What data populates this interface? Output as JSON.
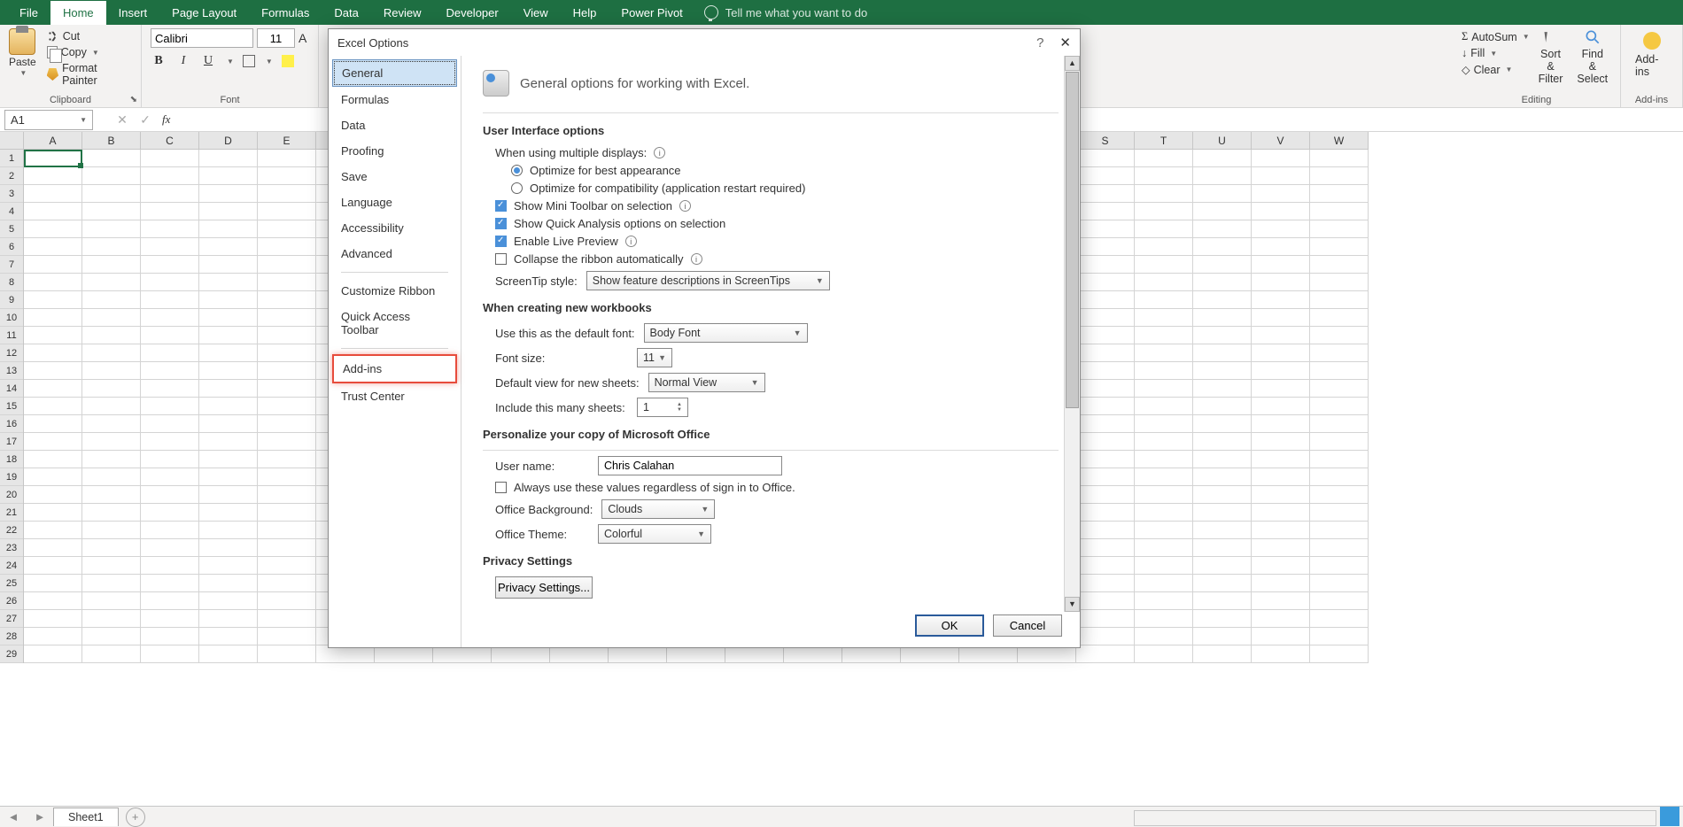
{
  "ribbon": {
    "tabs": [
      "File",
      "Home",
      "Insert",
      "Page Layout",
      "Formulas",
      "Data",
      "Review",
      "Developer",
      "View",
      "Help",
      "Power Pivot"
    ],
    "tellme": "Tell me what you want to do",
    "clipboard": {
      "paste": "Paste",
      "cut": "Cut",
      "copy": "Copy",
      "fmt": "Format Painter",
      "label": "Clipboard"
    },
    "font": {
      "name": "Calibri",
      "size": "11",
      "label": "Font",
      "bold": "B",
      "italic": "I",
      "underline": "U",
      "aa": "A"
    },
    "editing": {
      "autosum": "AutoSum",
      "fill": "Fill",
      "clear": "Clear",
      "sort": "Sort & Filter",
      "find": "Find & Select",
      "label": "Editing"
    },
    "addins": {
      "label": "Add-ins",
      "group": "Add-ins"
    }
  },
  "formulabar": {
    "cell": "A1",
    "fx": "fx"
  },
  "grid": {
    "cols": [
      "A",
      "B",
      "C",
      "D",
      "E",
      "",
      "",
      "",
      "",
      "",
      "",
      "",
      "",
      "",
      "",
      "",
      "",
      "",
      "S",
      "T",
      "U",
      "V",
      "W"
    ],
    "rows_shown": 29
  },
  "sheets": {
    "active": "Sheet1"
  },
  "dialog": {
    "title": "Excel Options",
    "nav": [
      "General",
      "Formulas",
      "Data",
      "Proofing",
      "Save",
      "Language",
      "Accessibility",
      "Advanced",
      "Customize Ribbon",
      "Quick Access Toolbar",
      "Add-ins",
      "Trust Center"
    ],
    "header": "General options for working with Excel.",
    "s1": {
      "title": "User Interface options",
      "multi": "When using multiple displays:",
      "opt1": "Optimize for best appearance",
      "opt2": "Optimize for compatibility (application restart required)",
      "mini": "Show Mini Toolbar on selection",
      "quick": "Show Quick Analysis options on selection",
      "live": "Enable Live Preview",
      "collapse": "Collapse the ribbon automatically",
      "screentip_l": "ScreenTip style:",
      "screentip_v": "Show feature descriptions in ScreenTips"
    },
    "s2": {
      "title": "When creating new workbooks",
      "font_l": "Use this as the default font:",
      "font_v": "Body Font",
      "size_l": "Font size:",
      "size_v": "11",
      "view_l": "Default view for new sheets:",
      "view_v": "Normal View",
      "sheets_l": "Include this many sheets:",
      "sheets_v": "1"
    },
    "s3": {
      "title": "Personalize your copy of Microsoft Office",
      "user_l": "User name:",
      "user_v": "Chris Calahan",
      "always": "Always use these values regardless of sign in to Office.",
      "bg_l": "Office Background:",
      "bg_v": "Clouds",
      "theme_l": "Office Theme:",
      "theme_v": "Colorful"
    },
    "s4": {
      "title": "Privacy Settings",
      "btn": "Privacy Settings..."
    },
    "ok": "OK",
    "cancel": "Cancel"
  }
}
